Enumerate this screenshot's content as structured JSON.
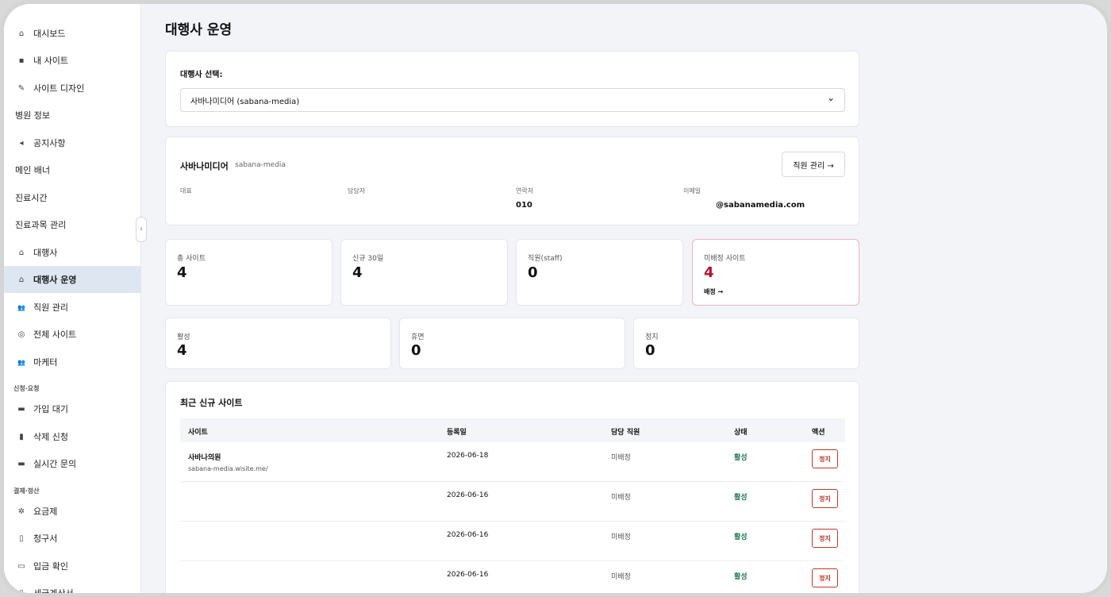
{
  "sidebar": {
    "items": [
      {
        "label": "대시보드",
        "icon": "home-icon",
        "glyph": "⌂"
      },
      {
        "label": "내 사이트",
        "icon": "grid-icon",
        "glyph": "▪"
      },
      {
        "label": "사이트 디자인",
        "icon": "wrench-icon",
        "glyph": "✎"
      },
      {
        "label": "병원 정보"
      },
      {
        "label": "공지사항",
        "icon": "megaphone-icon",
        "glyph": "◂"
      },
      {
        "label": "메인 배너"
      },
      {
        "label": "진료시간"
      },
      {
        "label": "진료과목 관리"
      },
      {
        "label": "대행사",
        "icon": "home-icon",
        "glyph": "⌂"
      },
      {
        "label": "대행사 운영",
        "icon": "home-icon",
        "glyph": "⌂"
      },
      {
        "label": "직원 관리",
        "icon": "users-icon",
        "glyph": "👥"
      },
      {
        "label": "전체 사이트",
        "icon": "globe-icon",
        "glyph": "◎"
      },
      {
        "label": "마케터",
        "icon": "users-icon",
        "glyph": "👥"
      },
      {
        "label": "가입 대기",
        "icon": "inbox-icon",
        "glyph": "▬"
      },
      {
        "label": "삭제 신청",
        "icon": "trash-icon",
        "glyph": "▮"
      },
      {
        "label": "실시간 문의",
        "icon": "inbox-icon",
        "glyph": "▬"
      },
      {
        "label": "요금제",
        "icon": "gear-icon",
        "glyph": "✲"
      },
      {
        "label": "청구서",
        "icon": "file-icon",
        "glyph": "▯"
      },
      {
        "label": "입금 확인",
        "icon": "card-icon",
        "glyph": "▭"
      },
      {
        "label": "세금계산서",
        "icon": "file-icon",
        "glyph": "▯"
      }
    ],
    "groups": [
      "신청·요청",
      "결제·정산"
    ],
    "collapse_glyph": "‹"
  },
  "page": {
    "title": "대행사 운영"
  },
  "agency_select": {
    "label": "대행사 선택:",
    "value": "사바나미디어 (sabana-media)",
    "chevron": "⌄"
  },
  "agency_info": {
    "name": "사바나미디어",
    "code": "sabana-media",
    "staff_button": "직원 관리 →",
    "fields": [
      {
        "label": "대표",
        "value": ""
      },
      {
        "label": "담당자",
        "value": ""
      },
      {
        "label": "연락처",
        "value": "010"
      },
      {
        "label": "이메일",
        "value": "@sabanamedia.com"
      }
    ]
  },
  "stats_top": [
    {
      "label": "총 사이트",
      "value": "4"
    },
    {
      "label": "신규 30일",
      "value": "4"
    },
    {
      "label": "직원(staff)",
      "value": "0"
    },
    {
      "label": "미배정 사이트",
      "value": "4",
      "link": "배정 →"
    }
  ],
  "stats_bottom": [
    {
      "label": "활성",
      "value": "4"
    },
    {
      "label": "휴면",
      "value": "0"
    },
    {
      "label": "정지",
      "value": "0"
    }
  ],
  "recent_sites": {
    "title": "최근 신규 사이트",
    "columns": [
      "사이트",
      "등록일",
      "담당 직원",
      "상태",
      "액션"
    ],
    "rows": [
      {
        "name": "사바나의원",
        "url": "sabana-media.wisite.me/",
        "date": "2026-06-18",
        "staff": "미배정",
        "status": "활성",
        "action": "정지"
      },
      {
        "name": "",
        "url": "",
        "date": "2026-06-16",
        "staff": "미배정",
        "status": "활성",
        "action": "정지"
      },
      {
        "name": "",
        "url": "",
        "date": "2026-06-16",
        "staff": "미배정",
        "status": "활성",
        "action": "정지"
      },
      {
        "name": "",
        "url": "",
        "date": "2026-06-16",
        "staff": "미배정",
        "status": "활성",
        "action": "정지"
      }
    ]
  },
  "colors": {
    "accent_red": "#b3122f",
    "status_green": "#1f7a4d",
    "active_bg": "#dde6f1"
  }
}
